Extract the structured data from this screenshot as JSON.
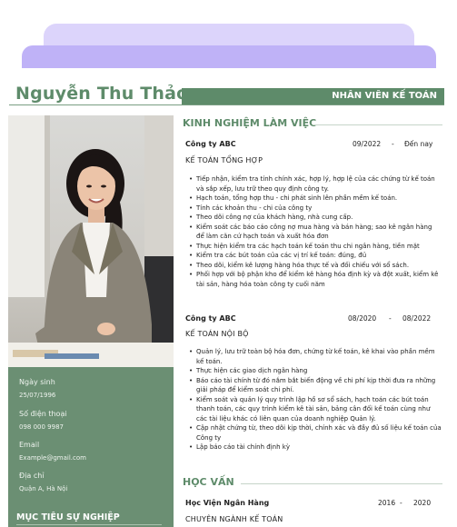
{
  "header": {
    "name": "Nguyễn Thu Thảo",
    "position": "NHÂN VIÊN KẾ TOÁN"
  },
  "contact": [
    {
      "label": "Ngày sinh",
      "value": "25/07/1996"
    },
    {
      "label": "Số điện thoại",
      "value": "098 000 9987"
    },
    {
      "label": "Email",
      "value": "Example@gmail.com"
    },
    {
      "label": "Địa chỉ",
      "value": "Quận A, Hà Nội"
    }
  ],
  "objective_title": "MỤC TIÊU SỰ NGHIỆP",
  "experience": {
    "title": "KINH NGHIỆM LÀM VIỆC",
    "jobs": [
      {
        "company": "Công ty ABC",
        "start": "09/2022",
        "sep": "-",
        "end": "Đến nay",
        "role": "KẾ TOÁN TỔNG HỢP",
        "bullets": [
          "Tiếp nhận, kiểm tra tính chính xác, hợp lý, hợp lệ của các chứng từ kế toán và sắp xếp, lưu trữ theo quy định công ty.",
          " Hạch toán, tổng hợp thu - chi phát sinh lên phần mềm kế toán.",
          "Tính các khoản thu - chi của công ty",
          "Theo dõi công nợ của khách hàng, nhà cung cấp.",
          "Kiểm soát các báo cáo công nợ mua hàng và bán hàng; sao kê ngân hàng để làm căn cứ hạch toán và xuất hóa đơn",
          "Thực hiện kiểm tra các hạch toán kế toán thu chi ngân hàng, tiền mặt",
          "Kiểm tra các bút toán của các vị trí kế toán: đúng, đủ",
          "Theo dõi, kiểm kê lượng hàng hóa thực tế và đối chiếu với sổ sách.",
          "Phối hợp với bộ phận kho để kiểm kê hàng hóa định kỳ và đột xuất, kiểm kê tài sản, hàng hóa toàn công ty cuối năm"
        ]
      },
      {
        "company": "Công ty ABC",
        "start": "08/2020",
        "sep": "-",
        "end": "08/2022",
        "role": "KẾ TOÁN NỘI BỘ",
        "bullets": [
          "Quản lý, lưu trữ toàn bộ hóa đơn, chứng từ kế toán, kê khai vào phần mềm kế toán.",
          "Thực hiện các giao dịch ngân hàng",
          "Báo cáo tài chính từ đó nắm bắt biến động về chi phí kịp thời đưa ra những giải pháp để kiểm soát chi phí.",
          "Kiểm soát và quản lý quy trình lập hồ sơ sổ sách, hạch toán các bút toán thanh toán, các quy trình kiểm kê tài sản, bảng cân đối kế toán cùng như các tài liệu khác có liên quan của doanh nghiệp Quản lý.",
          "Cập nhật chứng từ, theo dõi kịp thời, chính xác và đầy đủ số liệu kế toán của Công ty",
          "Lập báo cáo tài chính định kỳ"
        ]
      }
    ]
  },
  "education": {
    "title": "HỌC VẤN",
    "school": "Học Viện Ngân Hàng",
    "start": "2016",
    "sep": "-",
    "end": "2020",
    "major": "CHUYÊN NGÀNH KẾ TOÁN"
  },
  "colors": {
    "accent_green": "#5e8b6a",
    "panel_green": "#6b8f73",
    "deco_light_purple": "#dcd4fb",
    "deco_purple": "#bfb2f7"
  },
  "icons": {
    "bullet": "bullet-dot-icon"
  }
}
